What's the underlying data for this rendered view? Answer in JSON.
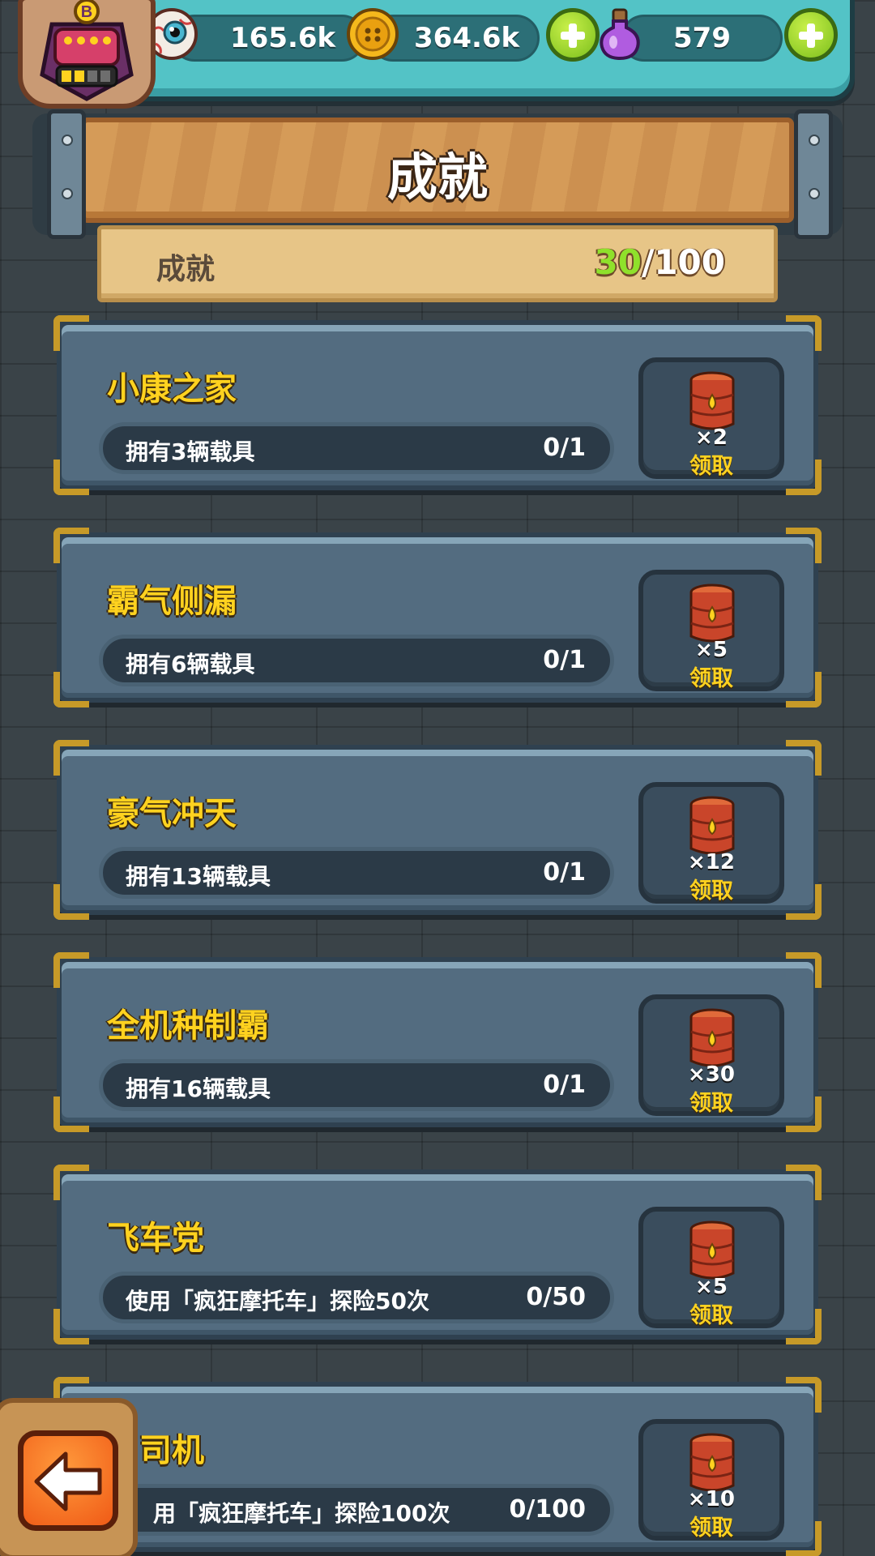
{
  "header": {
    "resources": [
      {
        "icon": "eyeball-icon",
        "value": "165.6k"
      },
      {
        "icon": "gold-coin-icon",
        "value": "364.6k"
      },
      {
        "icon": "potion-icon",
        "value": "579"
      }
    ],
    "avatar_badge": "B"
  },
  "page": {
    "title": "成就"
  },
  "summary": {
    "label": "成就",
    "done": "30",
    "total": "/100"
  },
  "achievements": [
    {
      "title": "小康之家",
      "desc": "拥有3辆载具",
      "progress": "0/1",
      "reward_qty": "×2",
      "claim_label": "领取"
    },
    {
      "title": "霸气侧漏",
      "desc": "拥有6辆载具",
      "progress": "0/1",
      "reward_qty": "×5",
      "claim_label": "领取"
    },
    {
      "title": "豪气冲天",
      "desc": "拥有13辆载具",
      "progress": "0/1",
      "reward_qty": "×12",
      "claim_label": "领取"
    },
    {
      "title": "全机种制霸",
      "desc": "拥有16辆载具",
      "progress": "0/1",
      "reward_qty": "×30",
      "claim_label": "领取"
    },
    {
      "title": "飞车党",
      "desc": "使用「疯狂摩托车」探险50次",
      "progress": "0/50",
      "reward_qty": "×5",
      "claim_label": "领取"
    },
    {
      "title": "司机",
      "desc": "用「疯狂摩托车」探险100次",
      "progress": "0/100",
      "reward_qty": "×10",
      "claim_label": "领取"
    }
  ],
  "colors": {
    "title_yellow": "#ffd21f",
    "progress_green": "#8fe12b",
    "card_blue": "#536c80",
    "topbar_teal": "#53c3c6"
  }
}
